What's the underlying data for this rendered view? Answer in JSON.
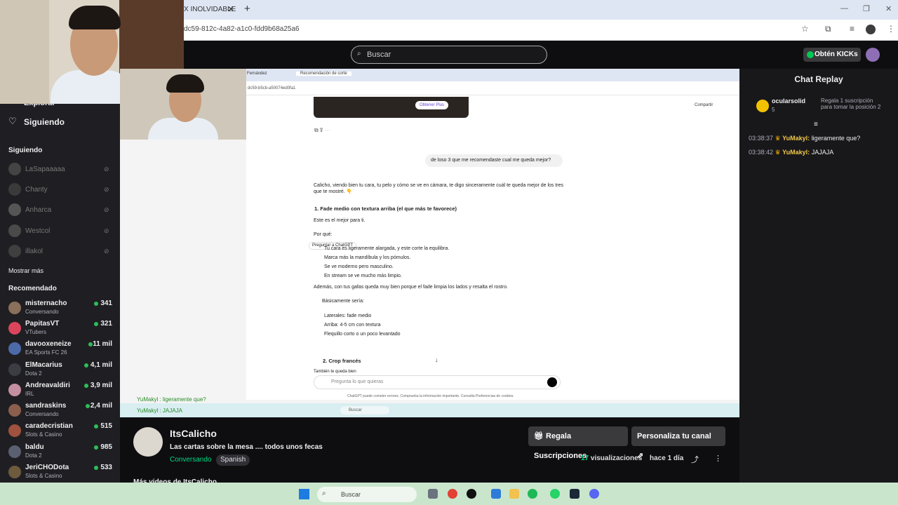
{
  "browser": {
    "tab_title": "X INOLVIDABLE",
    "url": "dc59-812c-4a82-a1c0-fdd9b68a25a6"
  },
  "twitch": {
    "search_placeholder": "Buscar",
    "kicks_label": "Obtén KICKs"
  },
  "sidebar": {
    "explore": "Explorar",
    "following_nav": "Siguiendo",
    "following_header": "Siguiendo",
    "following": [
      "LaSapaaaaa",
      "Chanty",
      "Anharca",
      "Westcol",
      "illakol"
    ],
    "show_more": "Mostrar más",
    "recommended_header": "Recomendado",
    "recommended": [
      {
        "name": "misternacho",
        "category": "Conversando",
        "viewers": "341",
        "color": "#8a6f5a"
      },
      {
        "name": "PapitasVT",
        "category": "VTubers",
        "viewers": "321",
        "color": "#d9465b"
      },
      {
        "name": "davooxeneize",
        "category": "EA Sports FC 26",
        "viewers": "11 mil",
        "color": "#4d6aa8"
      },
      {
        "name": "ElMacarius",
        "category": "Dota 2",
        "viewers": "4,1 mil",
        "color": "#3c3c44"
      },
      {
        "name": "Andreavaldiri",
        "category": "IRL",
        "viewers": "3,9 mil",
        "color": "#c48fa0"
      },
      {
        "name": "sandraskins",
        "category": "Conversando",
        "viewers": "2,4 mil",
        "color": "#8b5e4d"
      },
      {
        "name": "caradecristian",
        "category": "Slots & Casino",
        "viewers": "515",
        "color": "#a0523f"
      },
      {
        "name": "baldu",
        "category": "Dota 2",
        "viewers": "985",
        "color": "#5a6070"
      },
      {
        "name": "JeriCHODota",
        "category": "Slots & Casino",
        "viewers": "533",
        "color": "#6e5b3e"
      }
    ]
  },
  "video": {
    "inner_tabs": [
      "Fernández",
      "Recomendación de corte"
    ],
    "inner_url": "dc59-b5cb-a50074ed0fa1",
    "obtain_plus": "Obtener Plus",
    "share": "Compartir",
    "user_question": "de loso 3 que me recomendaste cual me queda mejor?",
    "intro": "Calicho, viendo bien tu cara, tu pelo y cómo se ve en cámara, te digo sinceramente cuál te queda mejor de los tres que te mostré. 👇",
    "option1": "1. Fade medio con textura arriba (el que más te favorece)",
    "best": "Este es el mejor para ti.",
    "why": "Por qué:",
    "ask_chatgpt": "Preguntar a ChatGPT",
    "bullet1": "Tu cara es ligeramente alargada, y este corte la equilibra.",
    "bullet2": "Marca más la mandíbula y los pómulos.",
    "bullet3": "Se ve moderno pero masculino.",
    "bullet4": "En stream se ve mucho más limpio.",
    "also": "Además, con tus gafas queda muy bien porque el fade limpia los lados y resalta el rostro.",
    "basically": "Básicamente sería:",
    "spec1": "Laterales: fade medio",
    "spec2": "Arriba: 4-5 cm con textura",
    "spec3": "Flequillo corto o un poco levantado",
    "option2": "2. Crop francés",
    "also_good": "También te queda bien",
    "input_placeholder": "Pregunta lo que quieras",
    "disclaimer": "ChatGPT puede cometer errores. Comprueba la información importante. Consulta Preferencias de cookies.",
    "inner_search": "Buscar",
    "overlay_chat": [
      "YuMakyl : ligeramente que?",
      "YuMakyl : JAJAJA"
    ]
  },
  "chat": {
    "header": "Chat Replay",
    "pinned_user": "ocularsolid",
    "pinned_count": "5",
    "pinned_text": "Regala 1 suscripción para tomar la posición 2",
    "messages": [
      {
        "time": "03:38:37",
        "user": "YuMakyl:",
        "text": "ligeramente que?"
      },
      {
        "time": "03:38:42",
        "user": "YuMakyl:",
        "text": "JAJAJA"
      }
    ]
  },
  "channel": {
    "name": "ItsCalicho",
    "title": "Las cartas sobre la mesa .... todos unos fecas",
    "category": "Conversando",
    "tag": "Spanish",
    "gift_button": "Regala Suscripciones",
    "customize_button": "Personaliza tu canal",
    "views_count": "17",
    "views_label": "visualizaciones",
    "date": "hace 1 día",
    "more_videos": "Más videos de ItsCalicho"
  },
  "taskbar": {
    "search_placeholder": "Buscar"
  }
}
